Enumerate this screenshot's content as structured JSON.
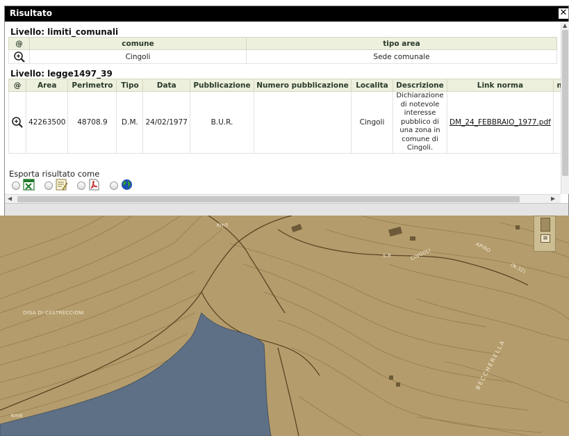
{
  "window": {
    "title": "Risultato",
    "close_glyph": "✕"
  },
  "layer1": {
    "title": "Livello: limiti_comunali",
    "columns": [
      "@",
      "comune",
      "tipo area"
    ],
    "rows": [
      {
        "comune": "Cingoli",
        "tipo_area": "Sede comunale"
      }
    ]
  },
  "layer2": {
    "title": "Livello: legge1497_39",
    "columns": [
      "@",
      "Area",
      "Perimetro",
      "Tipo",
      "Data",
      "Pubblicazione",
      "Numero pubblicazione",
      "Localita",
      "Descrizione",
      "Link norma",
      "nu"
    ],
    "rows": [
      {
        "area": "42263500",
        "perimetro": "48708.9",
        "tipo": "D.M.",
        "data": "24/02/1977",
        "pubblicazione": "B.U.R.",
        "numero_pubblicazione": "",
        "localita": "Cingoli",
        "descrizione_lines": [
          "Dichiarazione",
          "di notevole",
          "interesse",
          "pubblico di",
          "una zona in",
          "comune di",
          "Cingoli."
        ],
        "link_norma": "DM_24_FEBBRAIO_1977.pdf"
      }
    ]
  },
  "export": {
    "label": "Esporta risultato come",
    "options": [
      {
        "icon": "excel-icon",
        "color": "#1f7a2a"
      },
      {
        "icon": "text-edit-icon",
        "color": "#d8b84a"
      },
      {
        "icon": "pdf-icon",
        "color": "#c21e1e"
      },
      {
        "icon": "globe-icon",
        "color": "#1c4fb8"
      }
    ]
  },
  "map": {
    "labels": [
      "Km5",
      "DIGA DI CASTRECCIONI",
      "S.P.",
      "CINGOLI",
      "APIRO",
      "(N.32)",
      "BECCHERELLA",
      "Km6"
    ],
    "colors": {
      "land": "#b49c6c",
      "water": "#5e7085",
      "contour": "#8c7444",
      "road": "#5a4422"
    }
  }
}
